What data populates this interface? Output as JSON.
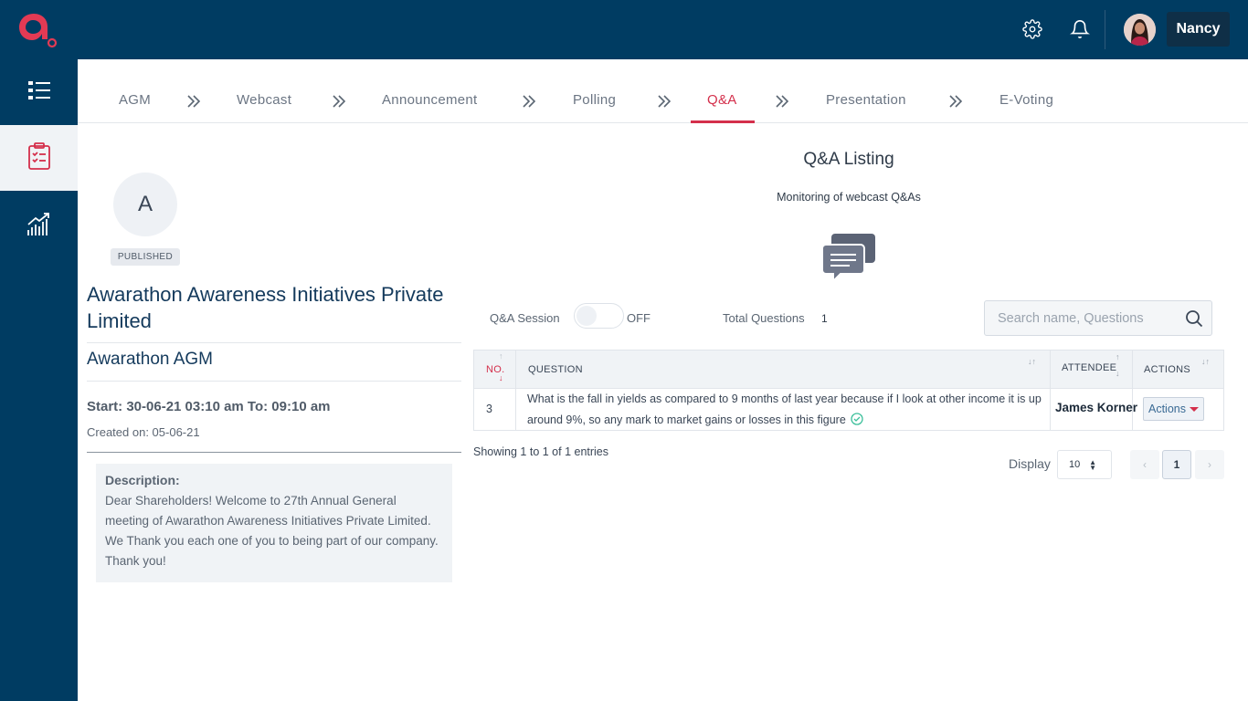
{
  "header": {
    "logo_icon": "logo-icon",
    "settings_icon": "gear-icon",
    "notifications_icon": "bell-icon",
    "user_name": "Nancy"
  },
  "sidebar": {
    "items": [
      {
        "icon": "list-icon",
        "active": false
      },
      {
        "icon": "clipboard-checklist-icon",
        "active": true
      },
      {
        "icon": "chart-growth-icon",
        "active": false
      }
    ]
  },
  "tabs": [
    {
      "label": "AGM",
      "active": false
    },
    {
      "label": "Webcast",
      "active": false
    },
    {
      "label": "Announcement",
      "active": false
    },
    {
      "label": "Polling",
      "active": false
    },
    {
      "label": "Q&A",
      "active": true
    },
    {
      "label": "Presentation",
      "active": false
    },
    {
      "label": "E-Voting",
      "active": false
    }
  ],
  "event": {
    "avatar_letter": "A",
    "status": "PUBLISHED",
    "company": "Awarathon Awareness Initiatives Private Limited",
    "meeting": "Awarathon AGM",
    "schedule": "Start: 30-06-21 03:10 am To: 09:10 am",
    "created": "Created on: 05-06-21",
    "description_title": "Description:",
    "description": "Dear Shareholders! Welcome to 27th Annual General meeting of Awarathon Awareness Initiatives Private Limited. We Thank you each one of you to being part of our company. Thank you!"
  },
  "qa": {
    "title": "Q&A Listing",
    "subtitle": "Monitoring of webcast Q&As",
    "session_label": "Q&A Session",
    "session_state": "OFF",
    "total_label": "Total Questions",
    "total_value": "1",
    "search_placeholder": "Search name, Questions",
    "columns": {
      "no": "NO.",
      "question": "QUESTION",
      "attendee": "ATTENDEE",
      "actions": "ACTIONS"
    },
    "rows": [
      {
        "no": "3",
        "question": "What is the fall in yields as compared to 9 months of last year because if I look at other income it is up around 9%, so any mark to market gains or losses in this figure",
        "attendee": "James Korner",
        "action": "Actions",
        "answered_icon": "check-circle-icon"
      }
    ],
    "showing": "Showing 1 to 1 of 1 entries",
    "display_label": "Display",
    "display_value": "10",
    "pagination": {
      "current": "1",
      "prev": "‹",
      "next": "›"
    }
  },
  "colors": {
    "navy": "#003c62",
    "accent": "#d42f4b",
    "panel": "#f0f3f6"
  }
}
